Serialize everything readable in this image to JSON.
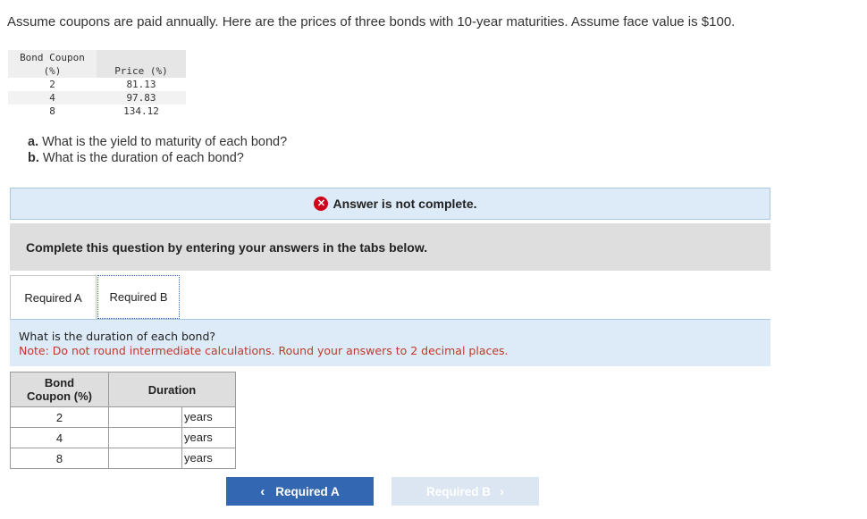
{
  "intro": "Assume coupons are paid annually. Here are the prices of three bonds with 10-year maturities. Assume face value is $100.",
  "price_table": {
    "headers": [
      "Bond Coupon\n(%)",
      "Price (%)"
    ],
    "rows": [
      [
        "2",
        "81.13"
      ],
      [
        "4",
        "97.83"
      ],
      [
        "8",
        "134.12"
      ]
    ]
  },
  "questions": [
    {
      "label": "a.",
      "text": " What is the yield to maturity of each bond?"
    },
    {
      "label": "b.",
      "text": " What is the duration of each bond?"
    }
  ],
  "status": {
    "text": "Answer is not complete.",
    "icon": "x-circle-icon",
    "icon_color": "#d0021b"
  },
  "instruction": "Complete this question by entering your answers in the tabs below.",
  "tabs": [
    {
      "label": "Required A"
    },
    {
      "label": "Required B"
    }
  ],
  "panel": {
    "question": "What is the duration of each bond?",
    "note": "Note: Do not round intermediate calculations. Round your answers to 2 decimal places."
  },
  "duration_table": {
    "headers": [
      "Bond\nCoupon (%)",
      "Duration"
    ],
    "rows": [
      {
        "coupon": "2",
        "value": "",
        "unit": "years"
      },
      {
        "coupon": "4",
        "value": "",
        "unit": "years"
      },
      {
        "coupon": "8",
        "value": "",
        "unit": "years"
      }
    ]
  },
  "nav": {
    "prev_label": "Required A",
    "next_label": "Required B",
    "prev_icon": "chevron-left-icon",
    "next_icon": "chevron-right-icon"
  },
  "colors": {
    "accent": "#3467b2",
    "error": "#d0021b",
    "note": "#c0392b",
    "panel_bg": "#dcebf7"
  }
}
